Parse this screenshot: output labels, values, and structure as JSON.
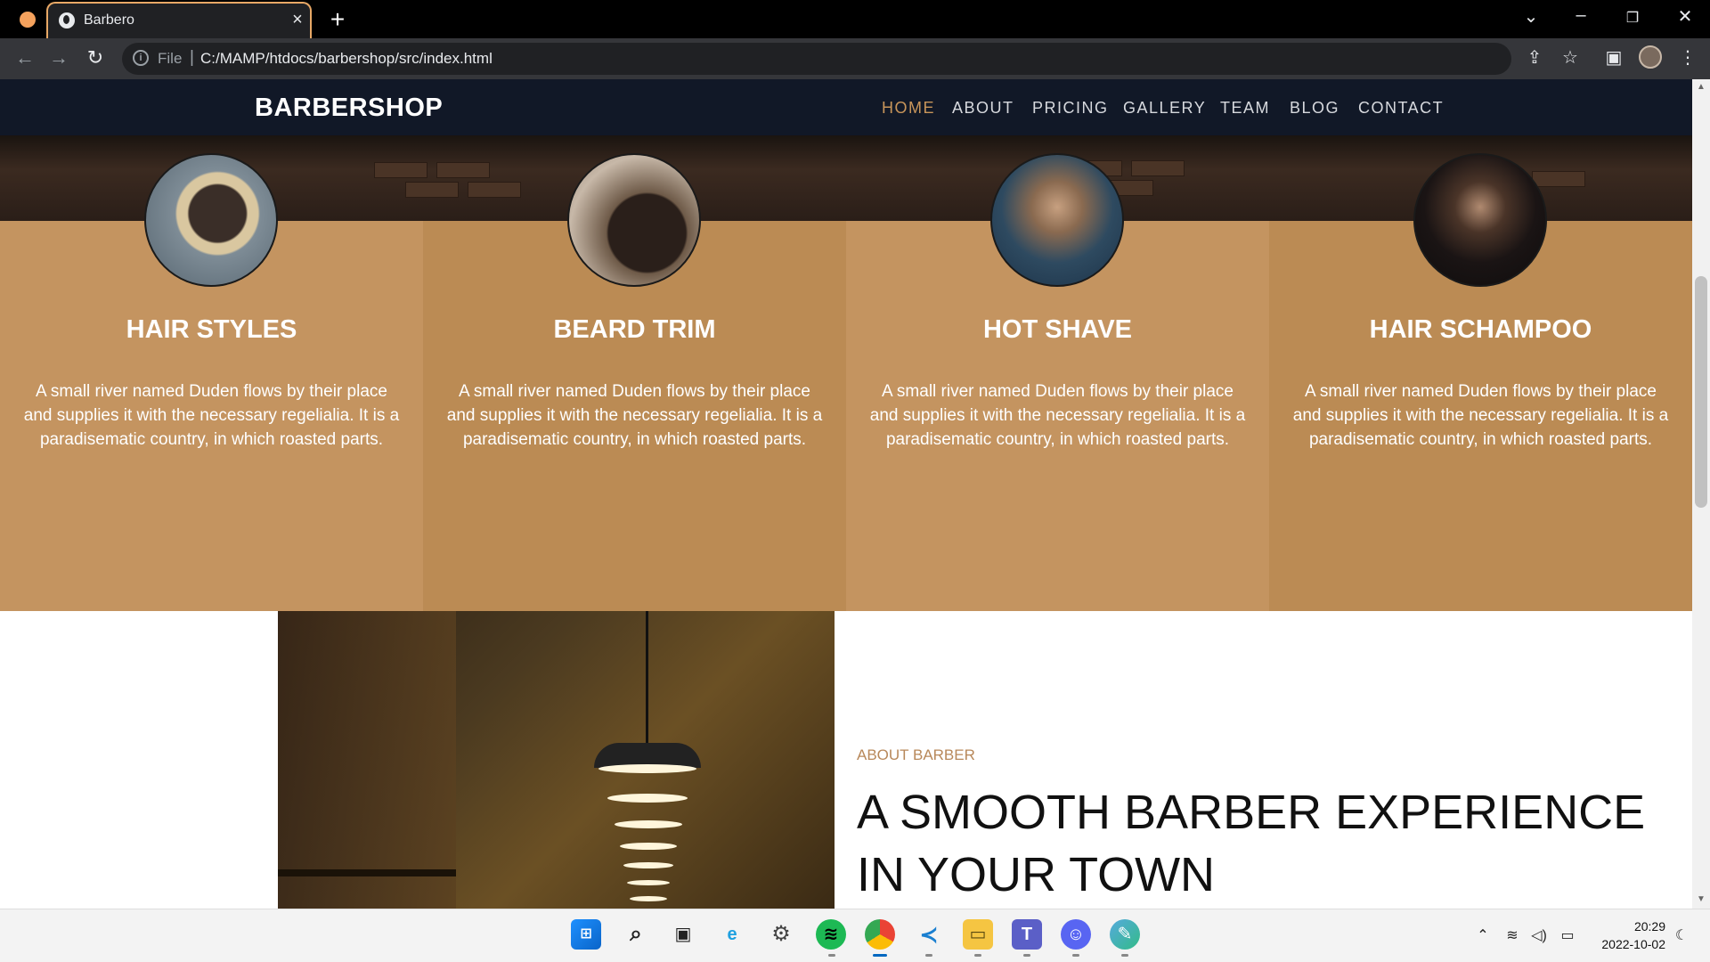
{
  "browser": {
    "tab_title": "Barbero",
    "close_glyph": "×",
    "new_tab_glyph": "+",
    "file_label": "File",
    "separator": "|",
    "url": "C:/MAMP/htdocs/barbershop/src/index.html"
  },
  "site": {
    "brand": "BARBERSHOP",
    "nav": [
      {
        "label": "HOME",
        "active": true
      },
      {
        "label": "ABOUT",
        "active": false
      },
      {
        "label": "PRICING",
        "active": false
      },
      {
        "label": "GALLERY",
        "active": false
      },
      {
        "label": "TEAM",
        "active": false
      },
      {
        "label": "BLOG",
        "active": false
      },
      {
        "label": "CONTACT",
        "active": false
      }
    ],
    "services": [
      {
        "title": "HAIR STYLES",
        "text": "A small river named Duden flows by their place and supplies it with the necessary regelialia. It is a paradisematic country, in which roasted parts.",
        "bg": "#c49460"
      },
      {
        "title": "BEARD TRIM",
        "text": "A small river named Duden flows by their place and supplies it with the necessary regelialia. It is a paradisematic country, in which roasted parts.",
        "bg": "#bb8b54"
      },
      {
        "title": "HOT SHAVE",
        "text": "A small river named Duden flows by their place and supplies it with the necessary regelialia. It is a paradisematic country, in which roasted parts.",
        "bg": "#c49460"
      },
      {
        "title": "HAIR SCHAMPOO",
        "text": "A small river named Duden flows by their place and supplies it with the necessary regelialia. It is a paradisematic country, in which roasted parts.",
        "bg": "#bb8b54"
      }
    ],
    "about_label": "ABOUT BARBER",
    "about_heading": "A SMOOTH BARBER EXPERIENCE IN YOUR TOWN"
  },
  "taskbar": {
    "time": "20:29",
    "date": "2022-10-02"
  },
  "colors": {
    "accent": "#c8955a",
    "nav_bg": "#111827",
    "active_tab_border": "#e8a866"
  }
}
